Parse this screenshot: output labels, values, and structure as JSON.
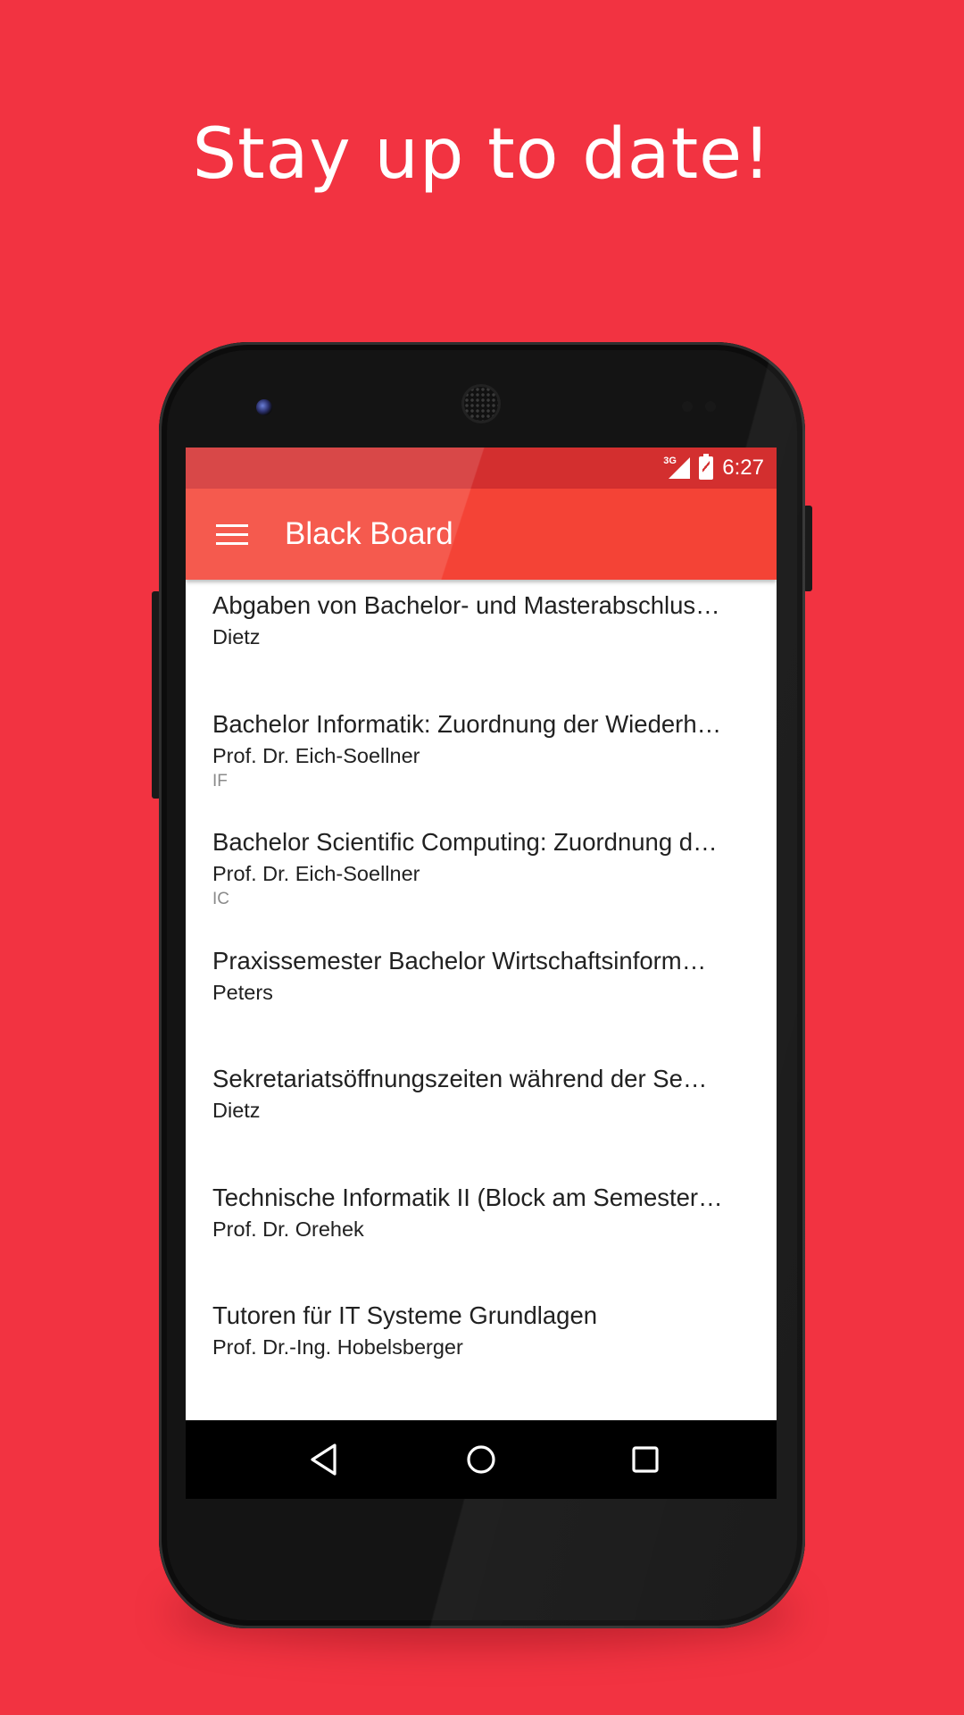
{
  "promo": {
    "headline": "Stay up to date!"
  },
  "status_bar": {
    "network": "3G",
    "time": "6:27"
  },
  "app_bar": {
    "title": "Black Board"
  },
  "posts": [
    {
      "title": "Abgaben von Bachelor- und Masterabschlus…",
      "author": "Dietz",
      "tag": ""
    },
    {
      "title": "Bachelor Informatik: Zuordnung der Wiederh…",
      "author": "Prof. Dr. Eich-Soellner",
      "tag": "IF"
    },
    {
      "title": "Bachelor Scientific Computing: Zuordnung d…",
      "author": "Prof. Dr. Eich-Soellner",
      "tag": "IC"
    },
    {
      "title": "Praxissemester Bachelor Wirtschaftsinform…",
      "author": "Peters",
      "tag": ""
    },
    {
      "title": "Sekretariatsöffnungszeiten während der Se…",
      "author": "Dietz",
      "tag": ""
    },
    {
      "title": "Technische Informatik II (Block am Semester…",
      "author": "Prof. Dr. Orehek",
      "tag": ""
    },
    {
      "title": "Tutoren für IT Systeme Grundlagen",
      "author": "Prof. Dr.-Ing. Hobelsberger",
      "tag": ""
    }
  ],
  "icons": {
    "menu": "hamburger-menu-icon",
    "signal": "cell-signal-icon",
    "battery": "battery-charging-icon",
    "back": "nav-back-icon",
    "home": "nav-home-icon",
    "recent": "nav-recent-apps-icon"
  },
  "colors": {
    "background": "#f23341",
    "status_bar": "#d32f2f",
    "app_bar": "#f44336",
    "list_background": "#ffffff",
    "nav_bar": "#000000"
  }
}
